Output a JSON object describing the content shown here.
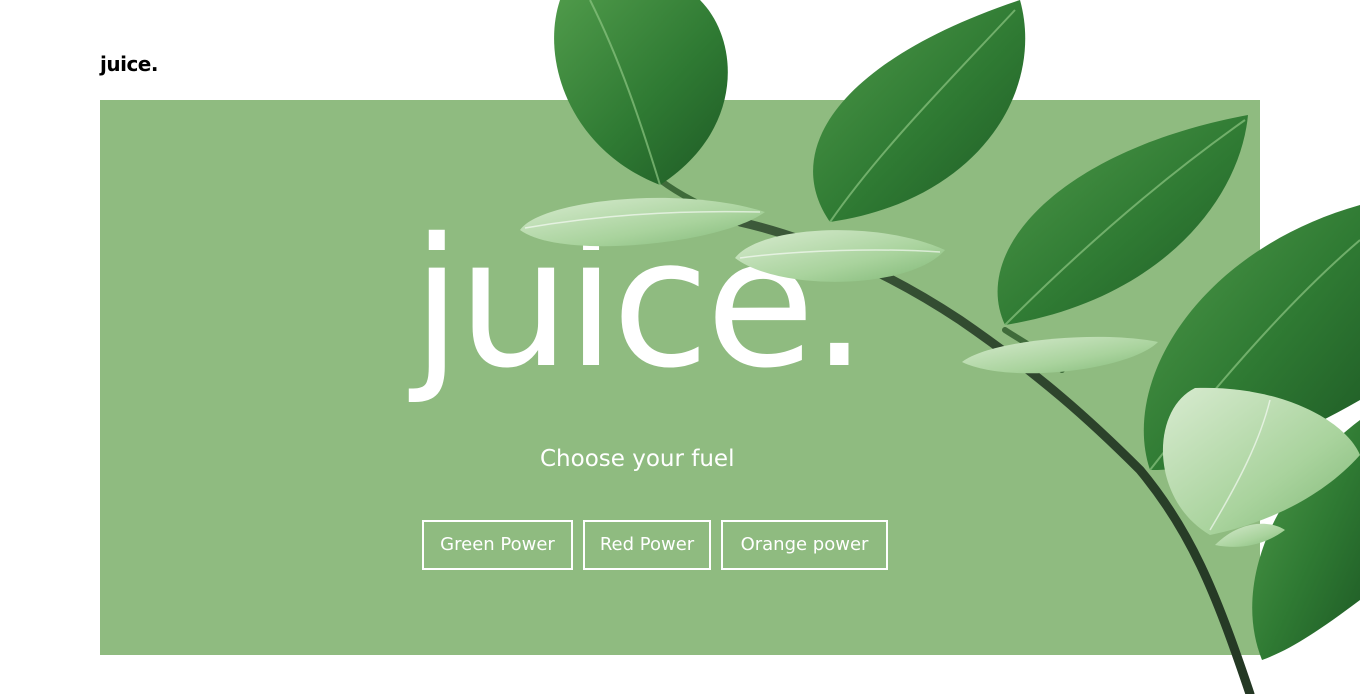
{
  "header": {
    "brand": "juice."
  },
  "hero": {
    "title": "juice.",
    "subtitle": "Choose your fuel",
    "background_color": "#8fbb80",
    "buttons": [
      {
        "label": "Green Power"
      },
      {
        "label": "Red Power"
      },
      {
        "label": "Orange power"
      }
    ]
  },
  "decoration": {
    "image": "green-leaves-branch-image"
  }
}
